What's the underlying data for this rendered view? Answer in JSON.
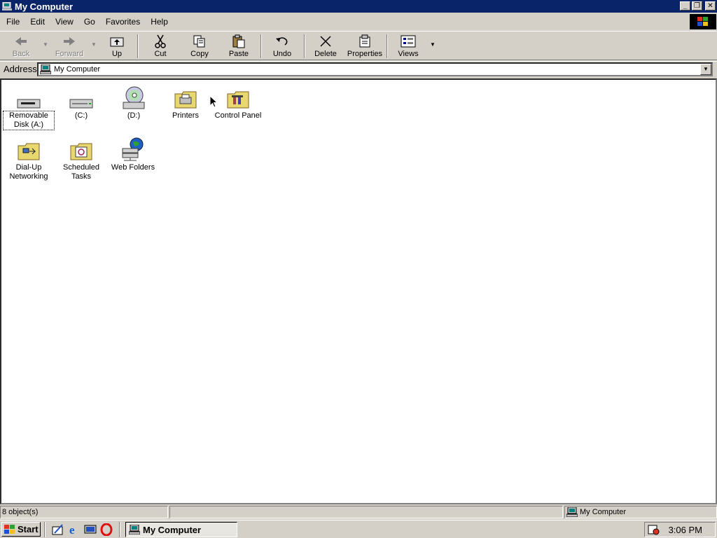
{
  "window": {
    "title": "My Computer",
    "controls": {
      "minimize": "_",
      "maximize": "❐",
      "close": "✕"
    }
  },
  "menubar": {
    "items": [
      {
        "label": "File",
        "hotkey": "F"
      },
      {
        "label": "Edit",
        "hotkey": "E"
      },
      {
        "label": "View",
        "hotkey": "V"
      },
      {
        "label": "Go",
        "hotkey": "G"
      },
      {
        "label": "Favorites",
        "hotkey": "a"
      },
      {
        "label": "Help",
        "hotkey": "H"
      }
    ]
  },
  "toolbar": {
    "back": "Back",
    "forward": "Forward",
    "up": "Up",
    "cut": "Cut",
    "copy": "Copy",
    "paste": "Paste",
    "undo": "Undo",
    "delete": "Delete",
    "properties": "Properties",
    "views": "Views"
  },
  "address": {
    "label": "Address",
    "value": "My Computer"
  },
  "items": [
    {
      "label": "Removable Disk (A:)",
      "icon": "floppy-drive-icon",
      "selected": true
    },
    {
      "label": "(C:)",
      "icon": "hard-drive-icon"
    },
    {
      "label": "(D:)",
      "icon": "cd-drive-icon"
    },
    {
      "label": "Printers",
      "icon": "printers-folder-icon"
    },
    {
      "label": "Control Panel",
      "icon": "control-panel-folder-icon"
    },
    {
      "label": "Dial-Up Networking",
      "icon": "dialup-networking-folder-icon"
    },
    {
      "label": "Scheduled Tasks",
      "icon": "scheduled-tasks-folder-icon"
    },
    {
      "label": "Web Folders",
      "icon": "web-folders-icon"
    }
  ],
  "status": {
    "count": "8 object(s)",
    "zone": "My Computer"
  },
  "taskbar": {
    "start": "Start",
    "task": "My Computer",
    "clock": "3:06 PM"
  }
}
